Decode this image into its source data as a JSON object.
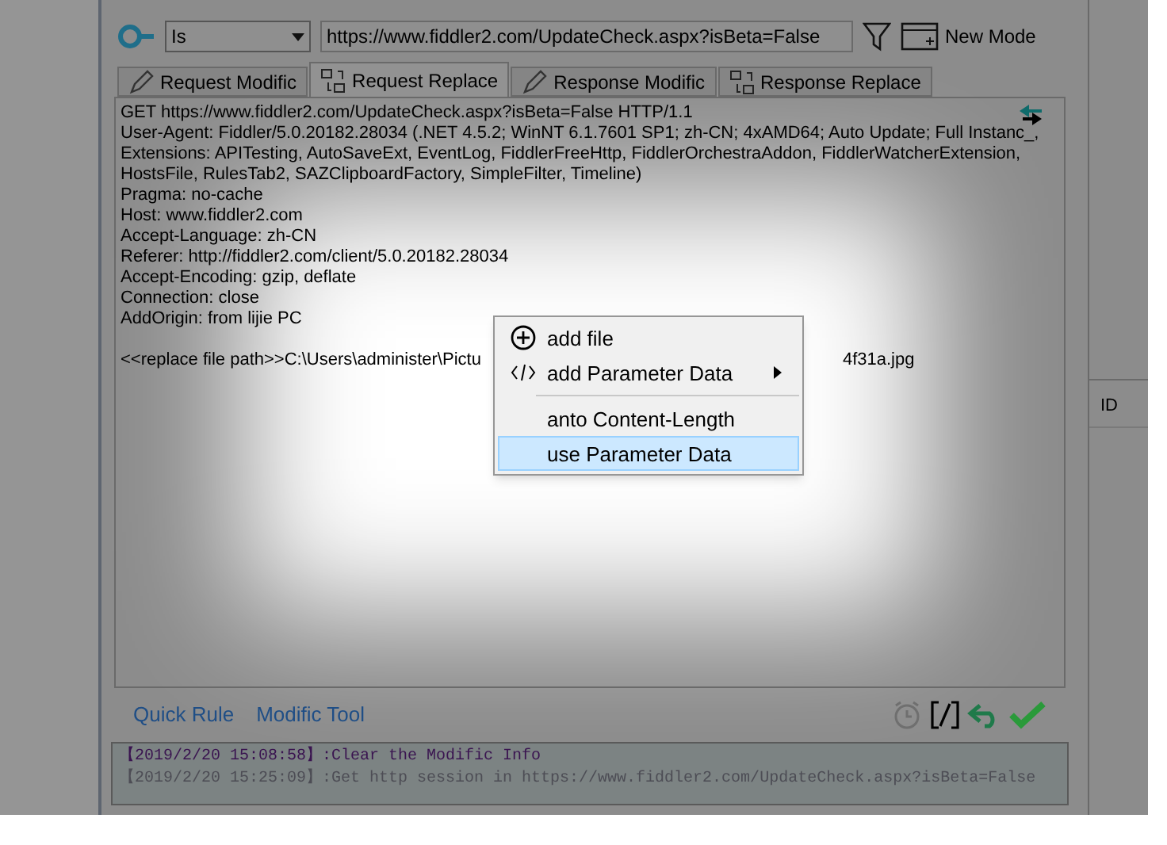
{
  "filter_bar": {
    "operator": "Is",
    "url": "https://www.fiddler2.com/UpdateCheck.aspx?isBeta=False",
    "new_mode_label": "New Mode"
  },
  "tabs": [
    {
      "label": "Request Modific",
      "kind": "modify",
      "selected": false
    },
    {
      "label": "Request Replace",
      "kind": "replace",
      "selected": true
    },
    {
      "label": "Response Modific",
      "kind": "modify",
      "selected": false
    },
    {
      "label": "Response Replace",
      "kind": "replace",
      "selected": false
    }
  ],
  "editor_lines": [
    "GET https://www.fiddler2.com/UpdateCheck.aspx?isBeta=False HTTP/1.1",
    "User-Agent: Fiddler/5.0.20182.28034 (.NET 4.5.2; WinNT 6.1.7601 SP1; zh-CN; 4xAMD64; Auto Update; Full Instanc_,",
    "Extensions: APITesting, AutoSaveExt, EventLog, FiddlerFreeHttp, FiddlerOrchestraAddon, FiddlerWatcherExtension,",
    "HostsFile, RulesTab2, SAZClipboardFactory, SimpleFilter, Timeline)",
    "Pragma: no-cache",
    "Host: www.fiddler2.com",
    "Accept-Language: zh-CN",
    "Referer: http://fiddler2.com/client/5.0.20182.28034",
    "Accept-Encoding: gzip, deflate",
    "Connection: close",
    "AddOrigin: from lijie PC"
  ],
  "replace_line": {
    "visible_start": "<<replace file path>>C:\\Users\\administer\\Pictu",
    "visible_end": "4f31a.jpg"
  },
  "context_menu": [
    {
      "kind": "file",
      "label": "add file",
      "submenu": false,
      "selected": false
    },
    {
      "kind": "code",
      "label": "add Parameter Data",
      "submenu": true,
      "selected": false
    },
    {
      "kind": "separator"
    },
    {
      "kind": "plain",
      "label": "anto Content-Length",
      "submenu": false,
      "selected": false
    },
    {
      "kind": "plain",
      "label": "use Parameter Data",
      "submenu": false,
      "selected": true
    }
  ],
  "right_panel": {
    "column_header": "ID"
  },
  "bottom_tabs": [
    "Quick Rule",
    "Modific Tool"
  ],
  "log": [
    "【2019/2/20 15:08:58】:Clear the Modific Info",
    "【2019/2/20 15:25:09】:Get http session in https://www.fiddler2.com/UpdateCheck.aspx?isBeta=False"
  ]
}
